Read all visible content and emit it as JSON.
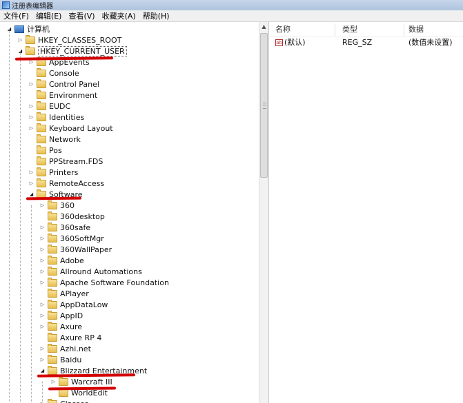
{
  "window": {
    "title": "注册表编辑器"
  },
  "menu": [
    "文件(F)",
    "编辑(E)",
    "查看(V)",
    "收藏夹(A)",
    "帮助(H)"
  ],
  "tree": [
    {
      "level": 0,
      "label": "计算机",
      "expander": "open",
      "icon": "computer-icon"
    },
    {
      "level": 1,
      "label": "HKEY_CLASSES_ROOT",
      "expander": "closed",
      "icon": "folder-icon"
    },
    {
      "level": 1,
      "label": "HKEY_CURRENT_USER",
      "expander": "open",
      "icon": "folder-icon",
      "selected": true
    },
    {
      "level": 2,
      "label": "AppEvents",
      "expander": "closed",
      "icon": "folder-icon"
    },
    {
      "level": 2,
      "label": "Console",
      "expander": "none",
      "icon": "folder-icon"
    },
    {
      "level": 2,
      "label": "Control Panel",
      "expander": "closed",
      "icon": "folder-icon"
    },
    {
      "level": 2,
      "label": "Environment",
      "expander": "none",
      "icon": "folder-icon"
    },
    {
      "level": 2,
      "label": "EUDC",
      "expander": "closed",
      "icon": "folder-icon"
    },
    {
      "level": 2,
      "label": "Identities",
      "expander": "closed",
      "icon": "folder-icon"
    },
    {
      "level": 2,
      "label": "Keyboard Layout",
      "expander": "closed",
      "icon": "folder-icon"
    },
    {
      "level": 2,
      "label": "Network",
      "expander": "none",
      "icon": "folder-icon"
    },
    {
      "level": 2,
      "label": "Pos",
      "expander": "none",
      "icon": "folder-icon"
    },
    {
      "level": 2,
      "label": "PPStream.FDS",
      "expander": "none",
      "icon": "folder-icon"
    },
    {
      "level": 2,
      "label": "Printers",
      "expander": "closed",
      "icon": "folder-icon"
    },
    {
      "level": 2,
      "label": "RemoteAccess",
      "expander": "closed",
      "icon": "folder-icon"
    },
    {
      "level": 2,
      "label": "Software",
      "expander": "open",
      "icon": "folder-icon"
    },
    {
      "level": 3,
      "label": "360",
      "expander": "closed",
      "icon": "folder-icon"
    },
    {
      "level": 3,
      "label": "360desktop",
      "expander": "none",
      "icon": "folder-icon"
    },
    {
      "level": 3,
      "label": "360safe",
      "expander": "closed",
      "icon": "folder-icon"
    },
    {
      "level": 3,
      "label": "360SoftMgr",
      "expander": "closed",
      "icon": "folder-icon"
    },
    {
      "level": 3,
      "label": "360WallPaper",
      "expander": "closed",
      "icon": "folder-icon"
    },
    {
      "level": 3,
      "label": "Adobe",
      "expander": "closed",
      "icon": "folder-icon"
    },
    {
      "level": 3,
      "label": "Allround Automations",
      "expander": "closed",
      "icon": "folder-icon"
    },
    {
      "level": 3,
      "label": "Apache Software Foundation",
      "expander": "closed",
      "icon": "folder-icon"
    },
    {
      "level": 3,
      "label": "APlayer",
      "expander": "none",
      "icon": "folder-icon"
    },
    {
      "level": 3,
      "label": "AppDataLow",
      "expander": "closed",
      "icon": "folder-icon"
    },
    {
      "level": 3,
      "label": "AppID",
      "expander": "closed",
      "icon": "folder-icon"
    },
    {
      "level": 3,
      "label": "Axure",
      "expander": "closed",
      "icon": "folder-icon"
    },
    {
      "level": 3,
      "label": "Axure RP 4",
      "expander": "none",
      "icon": "folder-icon"
    },
    {
      "level": 3,
      "label": "Azhi.net",
      "expander": "closed",
      "icon": "folder-icon"
    },
    {
      "level": 3,
      "label": "Baidu",
      "expander": "closed",
      "icon": "folder-icon"
    },
    {
      "level": 3,
      "label": "Blizzard Entertainment",
      "expander": "open",
      "icon": "folder-icon"
    },
    {
      "level": 4,
      "label": "Warcraft III",
      "expander": "closed",
      "icon": "folder-icon"
    },
    {
      "level": 4,
      "label": "WorldEdit",
      "expander": "none",
      "icon": "folder-icon"
    },
    {
      "level": 3,
      "label": "Classes",
      "expander": "closed",
      "icon": "folder-icon"
    }
  ],
  "values_pane": {
    "columns": [
      "名称",
      "类型",
      "数据"
    ],
    "rows": [
      {
        "name": "(默认)",
        "type": "REG_SZ",
        "data": "(数值未设置)",
        "icon_text": "ab"
      }
    ]
  },
  "colors": {
    "annotation_red": "#d40000",
    "folder": "#e8bf4f"
  }
}
